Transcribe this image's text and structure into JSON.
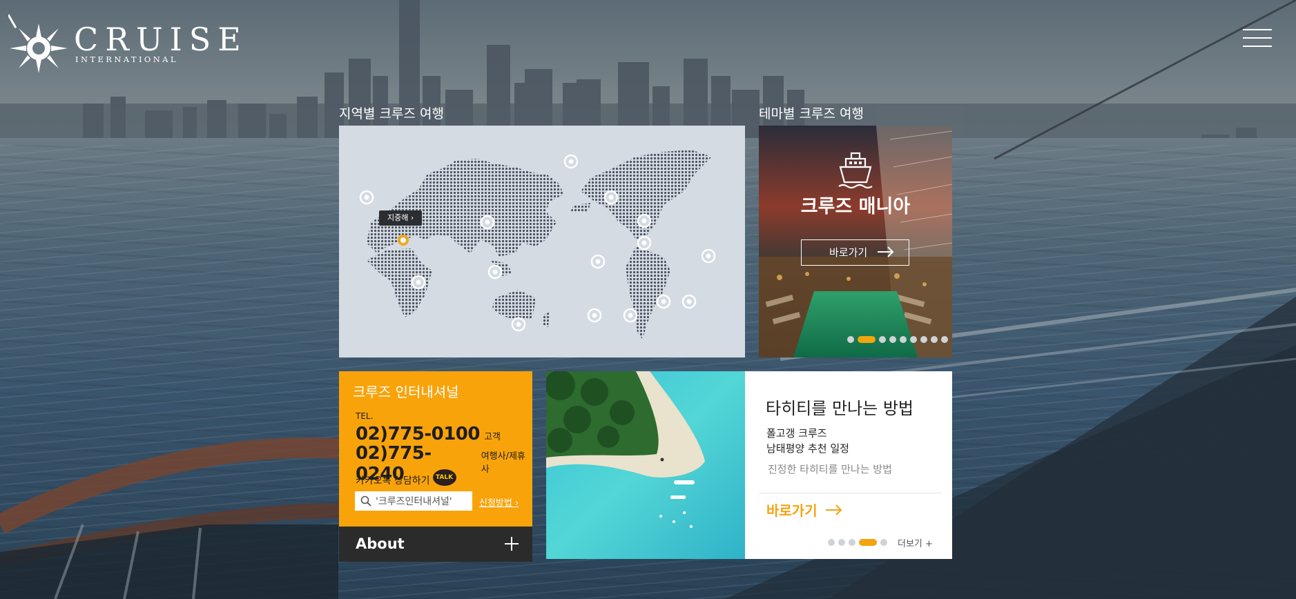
{
  "header": {
    "logo_word": "CRUISE",
    "logo_sub": "INTERNATIONAL"
  },
  "regional": {
    "title": "지역별 크루즈 여행",
    "tag_label": "지중해 ›"
  },
  "theme": {
    "title": "테마별 크루즈 여행",
    "headline": "크루즈 매니아",
    "button_label": "바로가기",
    "slide_count": 9,
    "active_slide": 1
  },
  "info": {
    "title": "크루즈 인터내셔널",
    "tel_label": "TEL.",
    "tel1": "02)775-0100",
    "tel1_note": "고객",
    "tel2": "02)775-0240",
    "tel2_note": "여행사/제휴사",
    "kakao_label": "카카오톡 상담하기",
    "talk_badge": "TALK",
    "search_value": "'크루즈인터내셔널'",
    "apply_label": "신청방법 ›",
    "about_label": "About"
  },
  "tahiti": {
    "title": "타히티를 만나는 방법",
    "line1": "폴고갱 크루즈",
    "line2": "남태평양 추천 일정",
    "line3": "진정한 타히티를 만나는 방법",
    "go_label": "바로가기",
    "more_label": "더보기 +",
    "slide_count": 5,
    "active_slide": 3
  },
  "colors": {
    "accent": "#f9a30b",
    "dark": "#2b2b2b",
    "map_bg": "#d4dbe2"
  }
}
